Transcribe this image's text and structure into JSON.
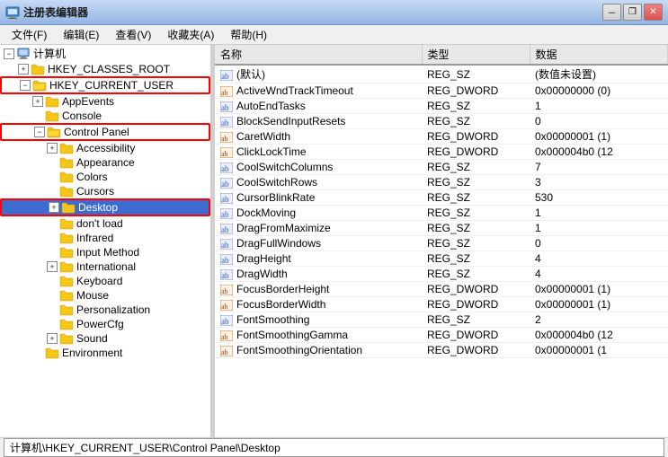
{
  "window": {
    "title": "注册表编辑器"
  },
  "menubar": {
    "items": [
      {
        "id": "file",
        "label": "文件(F)"
      },
      {
        "id": "edit",
        "label": "编辑(E)"
      },
      {
        "id": "view",
        "label": "查看(V)"
      },
      {
        "id": "favorites",
        "label": "收藏夹(A)"
      },
      {
        "id": "help",
        "label": "帮助(H)"
      }
    ]
  },
  "titlebar": {
    "minimize": "－",
    "restore": "❐",
    "close": "✕"
  },
  "tree": {
    "items": [
      {
        "id": "computer",
        "label": "计算机",
        "indent": 0,
        "expanded": true,
        "hasExpand": true,
        "isExpanded": true,
        "type": "computer"
      },
      {
        "id": "hkcr",
        "label": "HKEY_CLASSES_ROOT",
        "indent": 1,
        "expanded": false,
        "hasExpand": true,
        "isExpanded": false,
        "type": "folder"
      },
      {
        "id": "hkcu",
        "label": "HKEY_CURRENT_USER",
        "indent": 1,
        "expanded": true,
        "hasExpand": true,
        "isExpanded": true,
        "type": "folder",
        "highlighted": true
      },
      {
        "id": "appevents",
        "label": "AppEvents",
        "indent": 2,
        "hasExpand": true,
        "isExpanded": false,
        "type": "folder"
      },
      {
        "id": "console",
        "label": "Console",
        "indent": 2,
        "hasExpand": false,
        "isExpanded": false,
        "type": "folder"
      },
      {
        "id": "controlpanel",
        "label": "Control Panel",
        "indent": 2,
        "hasExpand": true,
        "isExpanded": true,
        "type": "folder",
        "highlighted": true
      },
      {
        "id": "accessibility",
        "label": "Accessibility",
        "indent": 3,
        "hasExpand": true,
        "isExpanded": false,
        "type": "folder"
      },
      {
        "id": "appearance",
        "label": "Appearance",
        "indent": 3,
        "hasExpand": false,
        "isExpanded": false,
        "type": "folder"
      },
      {
        "id": "colors",
        "label": "Colors",
        "indent": 3,
        "hasExpand": false,
        "isExpanded": false,
        "type": "folder"
      },
      {
        "id": "cursors",
        "label": "Cursors",
        "indent": 3,
        "hasExpand": false,
        "isExpanded": false,
        "type": "folder"
      },
      {
        "id": "desktop",
        "label": "Desktop",
        "indent": 3,
        "hasExpand": true,
        "isExpanded": false,
        "type": "folder",
        "selected": true,
        "highlighted": true
      },
      {
        "id": "dontload",
        "label": "don't load",
        "indent": 3,
        "hasExpand": false,
        "isExpanded": false,
        "type": "folder"
      },
      {
        "id": "infrared",
        "label": "Infrared",
        "indent": 3,
        "hasExpand": false,
        "isExpanded": false,
        "type": "folder"
      },
      {
        "id": "inputmethod",
        "label": "Input Method",
        "indent": 3,
        "hasExpand": false,
        "isExpanded": false,
        "type": "folder"
      },
      {
        "id": "international",
        "label": "International",
        "indent": 3,
        "hasExpand": true,
        "isExpanded": false,
        "type": "folder"
      },
      {
        "id": "keyboard",
        "label": "Keyboard",
        "indent": 3,
        "hasExpand": false,
        "isExpanded": false,
        "type": "folder"
      },
      {
        "id": "mouse",
        "label": "Mouse",
        "indent": 3,
        "hasExpand": false,
        "isExpanded": false,
        "type": "folder"
      },
      {
        "id": "personalization",
        "label": "Personalization",
        "indent": 3,
        "hasExpand": false,
        "isExpanded": false,
        "type": "folder"
      },
      {
        "id": "powercfg",
        "label": "PowerCfg",
        "indent": 3,
        "hasExpand": false,
        "isExpanded": false,
        "type": "folder"
      },
      {
        "id": "sound",
        "label": "Sound",
        "indent": 3,
        "hasExpand": true,
        "isExpanded": false,
        "type": "folder"
      },
      {
        "id": "environment",
        "label": "Environment",
        "indent": 2,
        "hasExpand": false,
        "isExpanded": false,
        "type": "folder"
      }
    ]
  },
  "table": {
    "columns": [
      {
        "id": "name",
        "label": "名称"
      },
      {
        "id": "type",
        "label": "类型"
      },
      {
        "id": "data",
        "label": "数据"
      }
    ],
    "rows": [
      {
        "name": "(默认)",
        "type": "REG_SZ",
        "data": "(数值未设置)",
        "icon": "ab"
      },
      {
        "name": "ActiveWndTrackTimeout",
        "type": "REG_DWORD",
        "data": "0x00000000 (0)",
        "icon": "dword"
      },
      {
        "name": "AutoEndTasks",
        "type": "REG_SZ",
        "data": "1",
        "icon": "ab"
      },
      {
        "name": "BlockSendInputResets",
        "type": "REG_SZ",
        "data": "0",
        "icon": "ab"
      },
      {
        "name": "CaretWidth",
        "type": "REG_DWORD",
        "data": "0x00000001 (1)",
        "icon": "dword"
      },
      {
        "name": "ClickLockTime",
        "type": "REG_DWORD",
        "data": "0x000004b0 (12",
        "icon": "dword"
      },
      {
        "name": "CoolSwitchColumns",
        "type": "REG_SZ",
        "data": "7",
        "icon": "ab"
      },
      {
        "name": "CoolSwitchRows",
        "type": "REG_SZ",
        "data": "3",
        "icon": "ab"
      },
      {
        "name": "CursorBlinkRate",
        "type": "REG_SZ",
        "data": "530",
        "icon": "ab"
      },
      {
        "name": "DockMoving",
        "type": "REG_SZ",
        "data": "1",
        "icon": "ab"
      },
      {
        "name": "DragFromMaximize",
        "type": "REG_SZ",
        "data": "1",
        "icon": "ab"
      },
      {
        "name": "DragFullWindows",
        "type": "REG_SZ",
        "data": "0",
        "icon": "ab"
      },
      {
        "name": "DragHeight",
        "type": "REG_SZ",
        "data": "4",
        "icon": "ab"
      },
      {
        "name": "DragWidth",
        "type": "REG_SZ",
        "data": "4",
        "icon": "ab"
      },
      {
        "name": "FocusBorderHeight",
        "type": "REG_DWORD",
        "data": "0x00000001 (1)",
        "icon": "dword"
      },
      {
        "name": "FocusBorderWidth",
        "type": "REG_DWORD",
        "data": "0x00000001 (1)",
        "icon": "dword"
      },
      {
        "name": "FontSmoothing",
        "type": "REG_SZ",
        "data": "2",
        "icon": "ab"
      },
      {
        "name": "FontSmoothingGamma",
        "type": "REG_DWORD",
        "data": "0x000004b0 (12",
        "icon": "dword"
      },
      {
        "name": "FontSmoothingOrientation",
        "type": "REG_DWORD",
        "data": "0x00000001 (1",
        "icon": "dword"
      }
    ]
  },
  "statusbar": {
    "path": "计算机\\HKEY_CURRENT_USER\\Control Panel\\Desktop"
  }
}
